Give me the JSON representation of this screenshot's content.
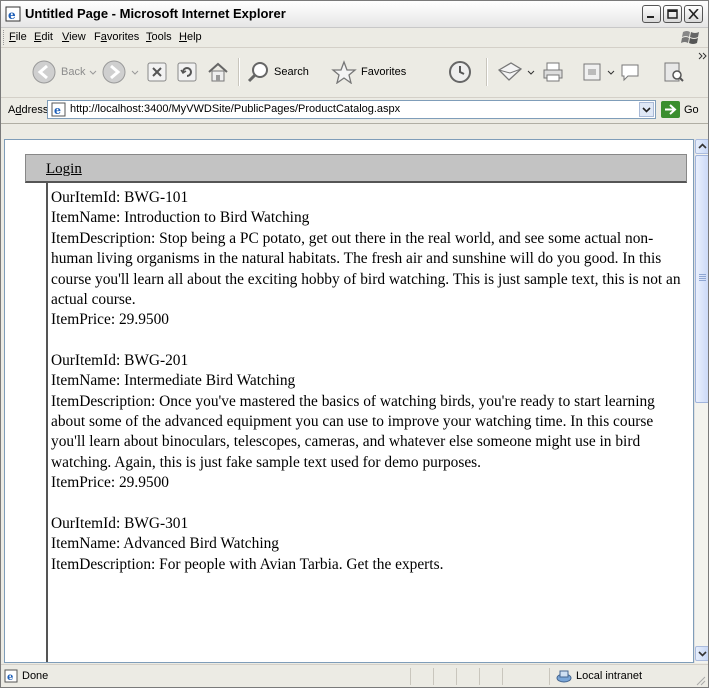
{
  "window": {
    "title": "Untitled Page - Microsoft Internet Explorer"
  },
  "menu": {
    "items": [
      {
        "key": "F",
        "rest": "ile"
      },
      {
        "key": "E",
        "rest": "dit"
      },
      {
        "key": "V",
        "rest": "iew"
      },
      {
        "pre": "F",
        "key": "a",
        "rest": "vorites"
      },
      {
        "key": "T",
        "rest": "ools"
      },
      {
        "key": "H",
        "rest": "elp"
      }
    ]
  },
  "toolbar": {
    "back_label": "Back",
    "search_label": "Search",
    "favorites_label": "Favorites"
  },
  "address": {
    "label_pre": "A",
    "label_key": "d",
    "label_rest": "dress",
    "url": "http://localhost:3400/MyVWDSite/PublicPages/ProductCatalog.aspx",
    "go_label": "Go"
  },
  "page": {
    "login_link": "Login",
    "items": [
      {
        "id_line": "OurItemId: BWG-101",
        "name_line": "ItemName: Introduction to Bird Watching",
        "desc_line": "ItemDescription: Stop being a PC potato, get out there in the real world, and see some actual non-human living organisms in the natural habitats. The fresh air and sunshine will do you good. In this course you'll learn all about the exciting hobby of bird watching. This is just sample text, this is not an actual course.",
        "price_line": "ItemPrice: 29.9500"
      },
      {
        "id_line": "OurItemId: BWG-201",
        "name_line": "ItemName: Intermediate Bird Watching",
        "desc_line": "ItemDescription: Once you've mastered the basics of watching birds, you're ready to start learning about some of the advanced equipment you can use to improve your watching time. In this course you'll learn about binoculars, telescopes, cameras, and whatever else someone might use in bird watching. Again, this is just fake sample text used for demo purposes.",
        "price_line": "ItemPrice: 29.9500"
      },
      {
        "id_line": "OurItemId: BWG-301",
        "name_line": "ItemName: Advanced Bird Watching",
        "desc_line": "ItemDescription: For people with Avian Tarbia. Get the experts.",
        "price_line": ""
      }
    ]
  },
  "status": {
    "text": "Done",
    "zone": "Local intranet"
  }
}
